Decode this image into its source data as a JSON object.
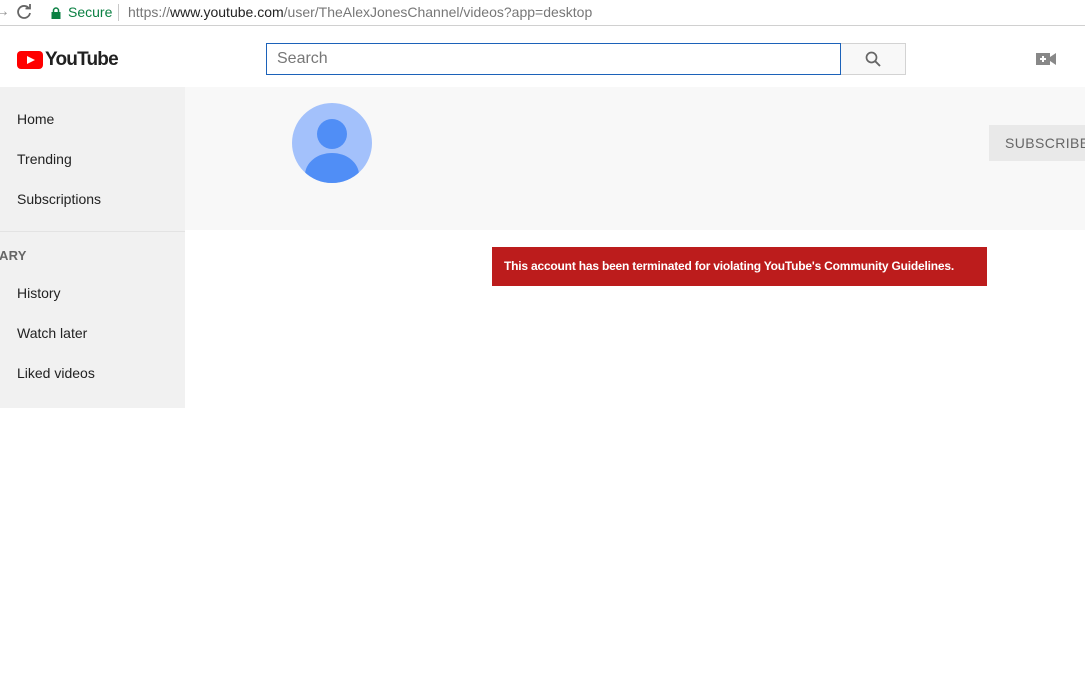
{
  "browser": {
    "secure_label": "Secure",
    "url_scheme": "https://",
    "url_host": "www.youtube.com",
    "url_path": "/user/TheAlexJonesChannel/videos?app=desktop",
    "secure_color": "#0b8043"
  },
  "masthead": {
    "logo_text": "YouTube",
    "search_placeholder": "Search",
    "brand_color": "#ff0000"
  },
  "sidebar": {
    "main_items": [
      {
        "label": "Home"
      },
      {
        "label": "Trending"
      },
      {
        "label": "Subscriptions"
      }
    ],
    "library_heading": "ARY",
    "library_items": [
      {
        "label": "History"
      },
      {
        "label": "Watch later"
      },
      {
        "label": "Liked videos"
      }
    ]
  },
  "channel": {
    "subscribe_label": "SUBSCRIBED"
  },
  "alert": {
    "message": "This account has been terminated for violating YouTube's Community Guidelines.",
    "background_color": "#bc1c1c"
  },
  "icons": {
    "reload": "reload-icon",
    "lock": "lock-icon",
    "search": "search-icon",
    "upload": "video-camera-plus-icon",
    "avatar": "default-avatar-icon"
  }
}
